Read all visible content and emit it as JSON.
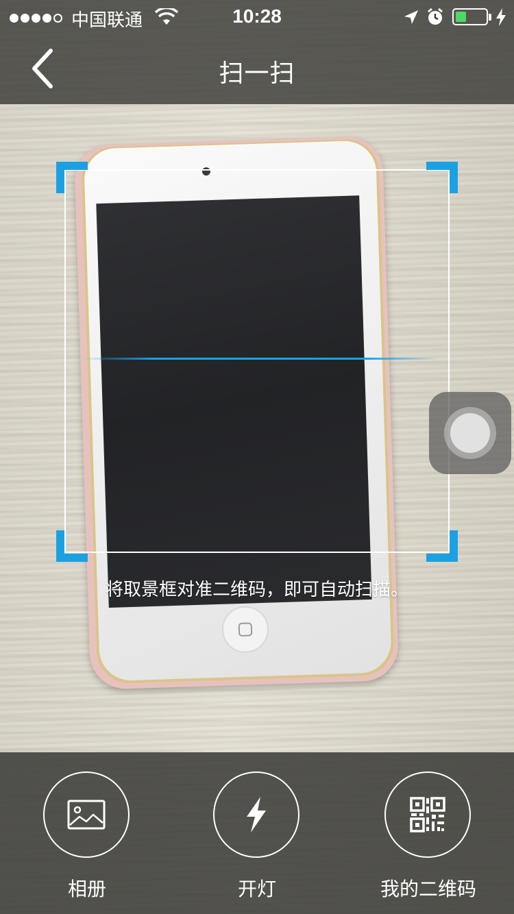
{
  "status_bar": {
    "carrier": "中国联通",
    "time": "10:28",
    "battery_level": 0.35,
    "signal_bars_filled": 4,
    "signal_bars_total": 5
  },
  "nav": {
    "title": "扫一扫",
    "back_icon": "chevron-left-icon"
  },
  "scanner": {
    "hint": "将取景框对准二维码，即可自动扫描。",
    "accent_color": "#1ba1e2"
  },
  "toolbar": {
    "items": [
      {
        "label": "相册",
        "icon": "image-icon"
      },
      {
        "label": "开灯",
        "icon": "flash-icon"
      },
      {
        "label": "我的二维码",
        "icon": "qr-code-icon"
      }
    ]
  }
}
